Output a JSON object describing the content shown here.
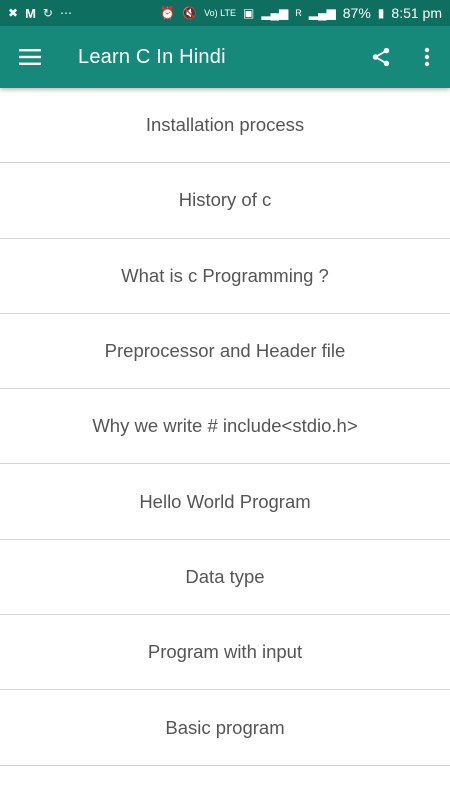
{
  "status_bar": {
    "left_icons": [
      "missed-call-icon",
      "gmail-icon",
      "sync-icon",
      "more-notifications-icon"
    ],
    "battery": "87%",
    "time": "8:51 pm",
    "volte_label": "Vo) LTE",
    "roaming_label": "R"
  },
  "app_bar": {
    "title": "Learn C In Hindi",
    "background": "#16897a",
    "status_background": "#0e6f60"
  },
  "topics": [
    "Installation process",
    "History of c",
    "What is c Programming ?",
    "Preprocessor and Header file",
    "Why we write # include<stdio.h>",
    "Hello World Program",
    "Data type",
    "Program with input",
    "Basic program"
  ]
}
